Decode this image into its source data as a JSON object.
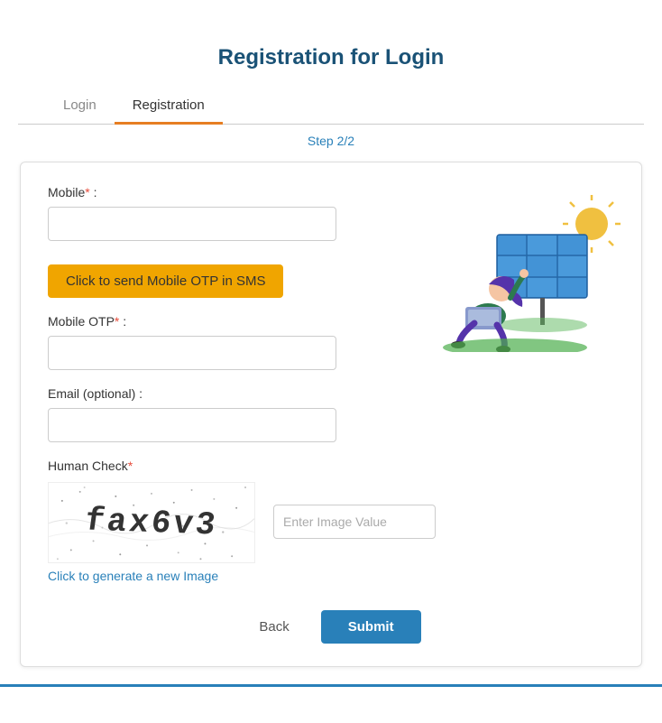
{
  "page": {
    "title": "Registration for Login"
  },
  "tabs": [
    {
      "id": "login",
      "label": "Login",
      "active": false
    },
    {
      "id": "registration",
      "label": "Registration",
      "active": true
    }
  ],
  "step": {
    "text": "Step 2/2"
  },
  "form": {
    "mobile_label": "Mobile",
    "mobile_required": "*",
    "mobile_colon": " :",
    "mobile_placeholder": "",
    "otp_button_label": "Click to send Mobile OTP in SMS",
    "mobile_otp_label": "Mobile OTP",
    "mobile_otp_required": "*",
    "mobile_otp_colon": " :",
    "mobile_otp_placeholder": "",
    "email_label": "Email (optional)",
    "email_colon": " :",
    "email_placeholder": "",
    "human_check_label": "Human Check",
    "human_check_required": "*",
    "captcha_value": "fax6v3",
    "captcha_input_placeholder": "Enter Image Value",
    "generate_link": "Click to generate a new Image",
    "back_button": "Back",
    "submit_button": "Submit"
  }
}
